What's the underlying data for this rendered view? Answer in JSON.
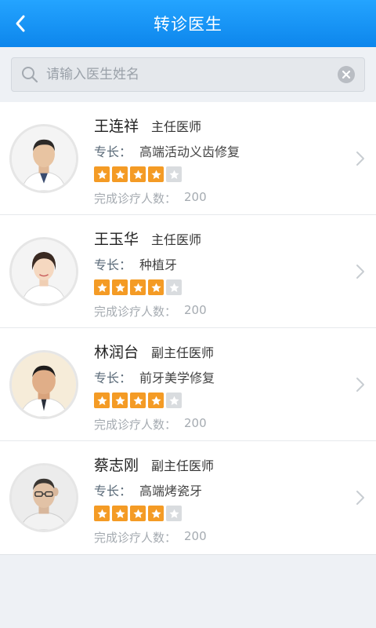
{
  "header": {
    "title": "转诊医生"
  },
  "search": {
    "placeholder": "请输入医生姓名",
    "value": ""
  },
  "colors": {
    "accent": "#1196f5",
    "star_on": "#f49b25",
    "star_off": "#d9dcdf"
  },
  "icons": {
    "back": "back-arrow-icon",
    "search": "search-icon",
    "clear": "clear-icon",
    "star": "star-icon",
    "chevron": "chevron-right-icon"
  },
  "doctors": [
    {
      "name": "王连祥",
      "title": "主任医师",
      "specialty_label": "专长：",
      "specialty": "高端活动义齿修复",
      "rating": 4,
      "rating_max": 5,
      "count_label": "完成诊疗人数：",
      "count": "200"
    },
    {
      "name": "王玉华",
      "title": "主任医师",
      "specialty_label": "专长：",
      "specialty": "种植牙",
      "rating": 4,
      "rating_max": 5,
      "count_label": "完成诊疗人数：",
      "count": "200"
    },
    {
      "name": "林润台",
      "title": "副主任医师",
      "specialty_label": "专长：",
      "specialty": "前牙美学修复",
      "rating": 4,
      "rating_max": 5,
      "count_label": "完成诊疗人数：",
      "count": "200"
    },
    {
      "name": "蔡志刚",
      "title": "副主任医师",
      "specialty_label": "专长：",
      "specialty": "高端烤瓷牙",
      "rating": 4,
      "rating_max": 5,
      "count_label": "完成诊疗人数：",
      "count": "200"
    }
  ]
}
